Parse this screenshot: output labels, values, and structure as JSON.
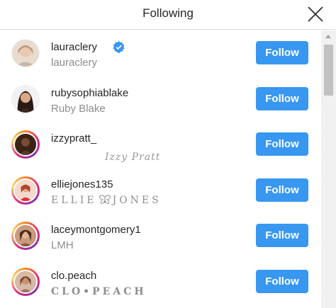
{
  "header": {
    "title": "Following",
    "close_icon": "close-icon"
  },
  "colors": {
    "accent": "#3897f0",
    "verified": "#3897f0",
    "secondary_text": "#8e8e8e"
  },
  "users": [
    {
      "username": "lauraclery",
      "fullname": "lauraclery",
      "verified": true,
      "story_ring": false,
      "button": "Follow"
    },
    {
      "username": "rubysophiablake",
      "fullname": "Ruby Blake",
      "verified": false,
      "story_ring": false,
      "button": "Follow"
    },
    {
      "username": "izzypratt_",
      "fullname": "Izzy Pratt",
      "verified": false,
      "story_ring": true,
      "button": "Follow"
    },
    {
      "username": "elliejones135",
      "fullname_left": "ELLIE",
      "fullname_right": "JONES",
      "verified": false,
      "story_ring": true,
      "button": "Follow"
    },
    {
      "username": "laceymontgomery1",
      "fullname": "LMH",
      "verified": false,
      "story_ring": true,
      "button": "Follow"
    },
    {
      "username": "clo.peach",
      "fullname": "CLO•PEACH",
      "verified": false,
      "story_ring": true,
      "button": "Follow"
    }
  ]
}
